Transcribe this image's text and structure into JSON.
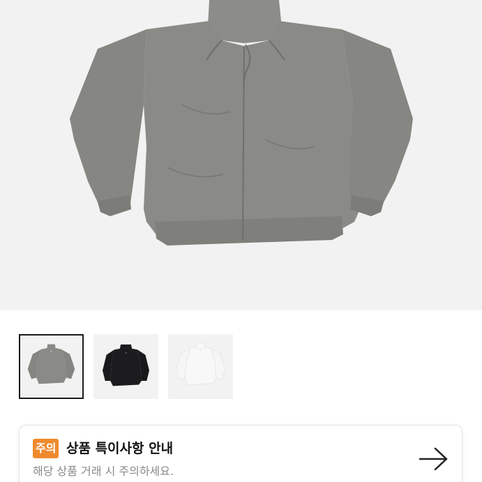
{
  "product": {
    "main_image": "gray-zip-hoodie-jacket",
    "thumbnails": [
      {
        "name": "gray-hoodie-thumbnail",
        "color": "#8a8a86",
        "selected": true
      },
      {
        "name": "black-hoodie-thumbnail",
        "color": "#1c1c1e",
        "selected": false
      },
      {
        "name": "white-hoodie-thumbnail",
        "color": "#f6f6f6",
        "selected": false
      }
    ]
  },
  "notice": {
    "badge": "주의",
    "title": "상품 특이사항 안내",
    "subtitle": "해당 상품 거래 시 주의하세요.",
    "arrow_icon": "arrow-right-icon"
  },
  "colors": {
    "badge_bg": "#ef8a2e",
    "image_bg": "#f2f2f2"
  }
}
